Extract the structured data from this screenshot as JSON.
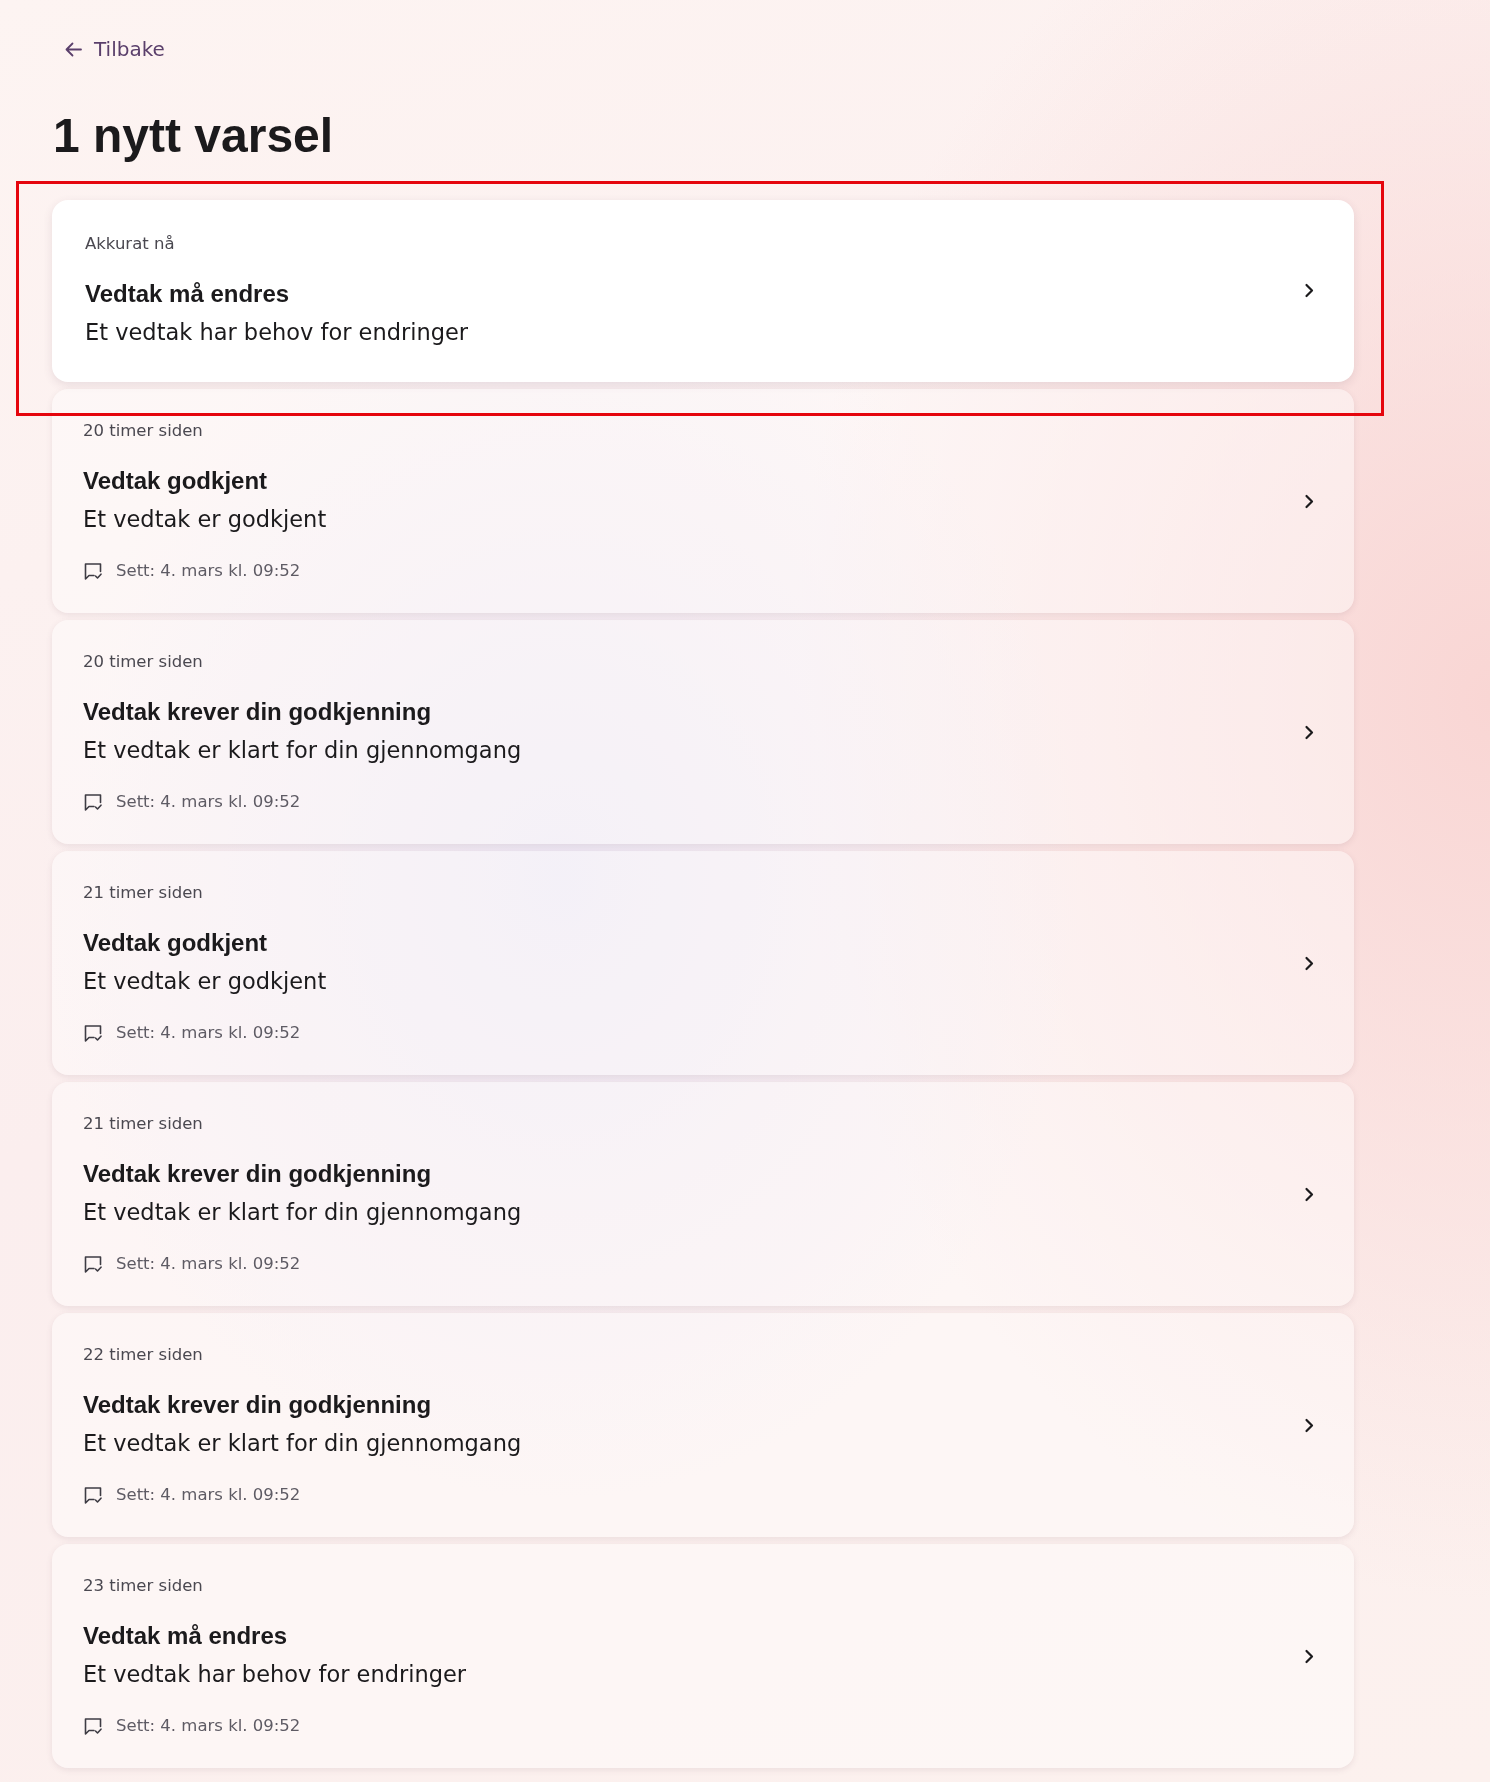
{
  "back_link": {
    "label": "Tilbake"
  },
  "heading": "1 nytt varsel",
  "notifications": [
    {
      "time": "Akkurat nå",
      "title": "Vedtak må endres",
      "body": "Et vedtak har behov for endringer",
      "unread": true,
      "highlighted": true
    },
    {
      "time": "20 timer siden",
      "title": "Vedtak godkjent",
      "body": "Et vedtak er godkjent",
      "seen": "Sett: 4. mars kl. 09:52",
      "unread": false,
      "highlighted": false
    },
    {
      "time": "20 timer siden",
      "title": "Vedtak krever din godkjenning",
      "body": "Et vedtak er klart for din gjennomgang",
      "seen": "Sett: 4. mars kl. 09:52",
      "unread": false,
      "highlighted": false
    },
    {
      "time": "21 timer siden",
      "title": "Vedtak godkjent",
      "body": "Et vedtak er godkjent",
      "seen": "Sett: 4. mars kl. 09:52",
      "unread": false,
      "highlighted": false
    },
    {
      "time": "21 timer siden",
      "title": "Vedtak krever din godkjenning",
      "body": "Et vedtak er klart for din gjennomgang",
      "seen": "Sett: 4. mars kl. 09:52",
      "unread": false,
      "highlighted": false
    },
    {
      "time": "22 timer siden",
      "title": "Vedtak krever din godkjenning",
      "body": "Et vedtak er klart for din gjennomgang",
      "seen": "Sett: 4. mars kl. 09:52",
      "unread": false,
      "highlighted": false
    },
    {
      "time": "23 timer siden",
      "title": "Vedtak må endres",
      "body": "Et vedtak har behov for endringer",
      "seen": "Sett: 4. mars kl. 09:52",
      "unread": false,
      "highlighted": false
    }
  ]
}
